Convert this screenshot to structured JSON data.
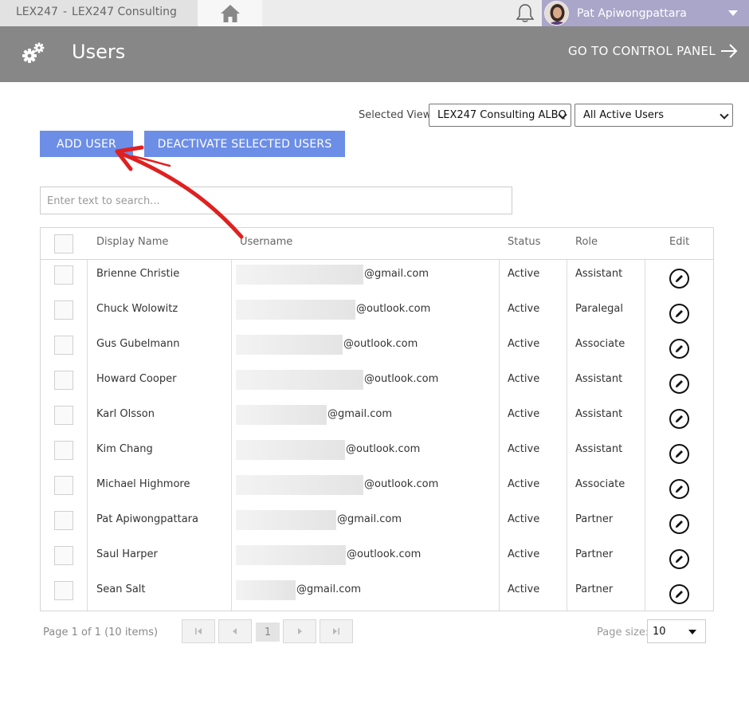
{
  "topbar": {
    "app_name": "LEX247",
    "separator": "-",
    "company": "LEX247 Consulting",
    "home_icon": "home-icon",
    "bell_icon": "bell-icon",
    "user_name": "Pat Apiwongpattara"
  },
  "header": {
    "title": "Users",
    "gear_icon": "gears-icon",
    "control_panel_link": "GO TO CONTROL PANEL",
    "arrow_icon": "arrow-right-icon"
  },
  "view": {
    "label": "Selected View:",
    "office_selected": "LEX247 Consulting ALBQ",
    "users_selected": "All Active Users"
  },
  "actions": {
    "add_user": "ADD USER",
    "deactivate": "DEACTIVATE SELECTED USERS"
  },
  "search": {
    "placeholder": "Enter text to search..."
  },
  "grid": {
    "columns": [
      "Display Name",
      "Username",
      "Status",
      "Role",
      "Edit"
    ],
    "rows": [
      {
        "name": "Brienne Christie",
        "domain": "@gmail.com",
        "status": "Active",
        "role": "Assistant"
      },
      {
        "name": "Chuck Wolowitz",
        "domain": "@outlook.com",
        "status": "Active",
        "role": "Paralegal"
      },
      {
        "name": "Gus Gubelmann",
        "domain": "@outlook.com",
        "status": "Active",
        "role": "Associate"
      },
      {
        "name": "Howard Cooper",
        "domain": "@outlook.com",
        "status": "Active",
        "role": "Assistant"
      },
      {
        "name": "Karl Olsson",
        "domain": "@gmail.com",
        "status": "Active",
        "role": "Assistant"
      },
      {
        "name": "Kim Chang",
        "domain": "@outlook.com",
        "status": "Active",
        "role": "Assistant"
      },
      {
        "name": "Michael Highmore",
        "domain": "@outlook.com",
        "status": "Active",
        "role": "Associate"
      },
      {
        "name": "Pat Apiwongpattara",
        "domain": "@gmail.com",
        "status": "Active",
        "role": "Partner"
      },
      {
        "name": "Saul Harper",
        "domain": "@outlook.com",
        "status": "Active",
        "role": "Partner"
      },
      {
        "name": "Sean Salt",
        "domain": "@gmail.com",
        "status": "Active",
        "role": "Partner"
      }
    ]
  },
  "pager": {
    "info": "Page 1 of 1 (10 items)",
    "current_page": "1",
    "page_size_label": "Page size:",
    "page_size": "10"
  },
  "colors": {
    "header_bg": "#878787",
    "button_blue": "#6c8ee6",
    "user_box": "#a9a6c9",
    "annotation_red": "#e02020"
  }
}
